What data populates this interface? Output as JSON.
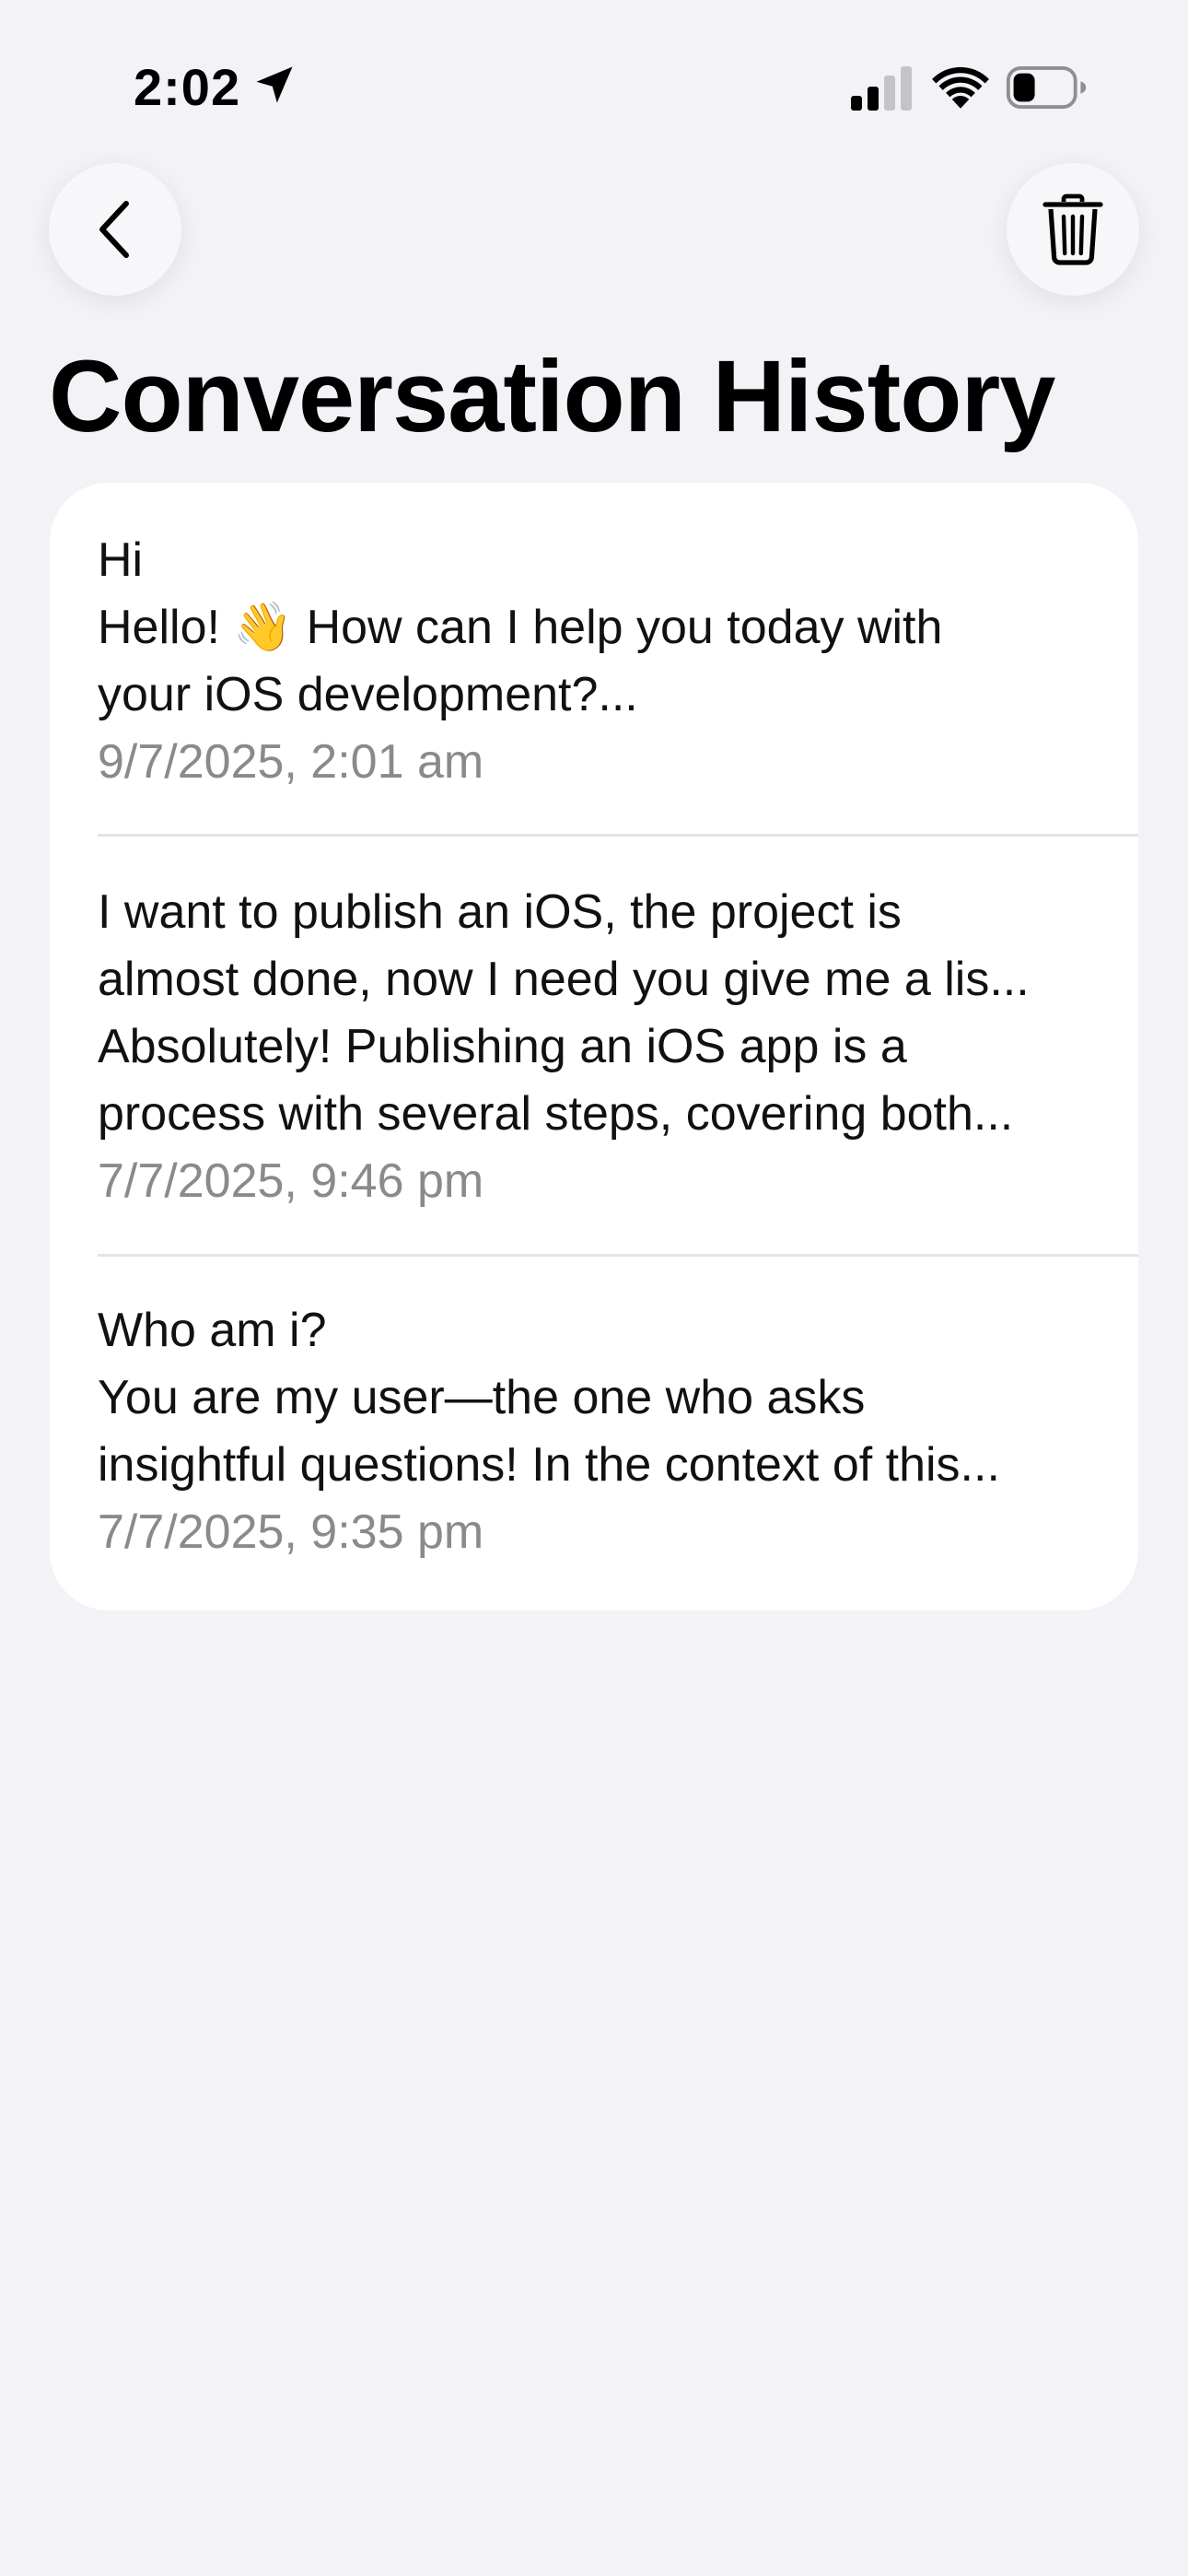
{
  "status_bar": {
    "time": "2:02",
    "icons": [
      "location-arrow-icon",
      "cellular-signal-icon",
      "wifi-icon",
      "battery-icon"
    ]
  },
  "nav": {
    "back_icon": "chevron-left-icon",
    "delete_icon": "trash-icon"
  },
  "page": {
    "title": "Conversation History"
  },
  "conversations": [
    {
      "lines": [
        "Hi",
        "Hello! 👋 How can I help you today with",
        "your iOS development?..."
      ],
      "date": "9/7/2025, 2:01 am"
    },
    {
      "lines": [
        "I want to publish an iOS, the project is",
        "almost done, now I need you give me a lis...",
        "Absolutely! Publishing an iOS app is a",
        "process with several steps, covering both..."
      ],
      "date": "7/7/2025, 9:46 pm"
    },
    {
      "lines": [
        "Who am i?",
        "You are my user—the one who asks",
        "insightful questions! In the context of this..."
      ],
      "date": "7/7/2025, 9:35 pm"
    }
  ],
  "colors": {
    "background": "#f2f2f7",
    "card": "#ffffff",
    "secondary_text": "#8a8a8e",
    "divider": "#e3e3e8"
  }
}
